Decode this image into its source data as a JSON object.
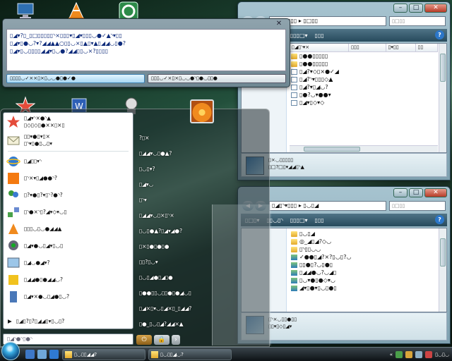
{
  "colors": {
    "accent": "#2b76c8",
    "taskbar": "#1b2226",
    "start_orb": "#3cb0e6",
    "dialog_text": "#0d2a7a"
  },
  "desktop": {
    "icons": [
      {
        "name": "computer-icon"
      },
      {
        "name": "vlc-icon"
      },
      {
        "name": "utorrent-icon"
      },
      {
        "name": "star-icon"
      },
      {
        "name": "word-icon"
      },
      {
        "name": "bot-icon"
      }
    ]
  },
  "dialog": {
    "lines": [
      "▯◢▾?▯_▯□▯▯▯▯▯◝×▯▯▯▾▯◢▾▯▯▯◡●✓▲◝▾▯▯",
      "▯◢▾▯●◡?▾?◢◢▲▲○▯▯◡×▯▲▯▾▲▯◢◢◡▯●?",
      "▯◢▾▯◡▯▯▯▯◢◢▾▯◡●?◢◢▯▯◡×?▯▯▯▯"
    ],
    "buttons": [
      {
        "label": "▯▯▯▯◡✓××▯×▯◡◡●▯●✓●"
      },
      {
        "label": "▯▯▯◡✓×▯×▯◡◡●◝▯●◡▯▯●"
      }
    ]
  },
  "window1": {
    "address": "▯◢▯◝▾▯▯▯ ▸ ▯□▯▯",
    "search_placeholder": "▯□▯▯",
    "toolbar": [
      "▯□▯▾",
      "▯▯◡▯◝",
      "▯▯▯□▾",
      "▯▯▯"
    ],
    "columns": [
      "▯◢▯◝▾×",
      "▯▯▯",
      "▯▾▯▯",
      "▯▯"
    ],
    "rows": [
      {
        "name": "▯●●▯▯▯▯▯",
        "type": "folder"
      },
      {
        "name": "▯●●▯▯▯▯▯",
        "type": "folder"
      },
      {
        "name": "▯◢?▾◇▯×●✓◢",
        "type": "file"
      },
      {
        "name": "▯◢?◝▾▯▯▯◇▲",
        "type": "file"
      },
      {
        "name": "▯◢?▾▯◢◡?",
        "type": "file"
      },
      {
        "name": "▯●?◡▾●●▾",
        "type": "file"
      },
      {
        "name": "▯◢▾▯◇▾◇",
        "type": "file"
      }
    ],
    "details": [
      "▯×◡▯▯▯▯▯",
      "▯□?□▯▾◢◢▯◝▲"
    ]
  },
  "window2": {
    "address": "▯◢▯◝▾▯▯▯ ▸ ▯◡▯◢",
    "search_placeholder": "▯□▯▯",
    "toolbar": [
      "▯□▯▾",
      "▯▯◡▯◝",
      "▯▯▯□▾",
      "▯▯▯"
    ],
    "rows": [
      {
        "name": "▯◡▯◢",
        "type": "folder"
      },
      {
        "name": "◎_◢▯◢?◇◡",
        "type": "folder"
      },
      {
        "name": "▯◝▯▯◡◡",
        "type": "folder"
      },
      {
        "name": "✓●●▯◢?×?▯◡▯?◡",
        "type": "img"
      },
      {
        "name": "▯▯●▯?◡▯●▯",
        "type": "img"
      },
      {
        "name": "▯◢◢●◡?◡◢▯",
        "type": "img"
      },
      {
        "name": "▯◡▾●▯●◇▾◡",
        "type": "img"
      },
      {
        "name": "◢▾▯●▾▯◡▯●▯",
        "type": "img"
      }
    ],
    "details": [
      "▯◝×◡▯▯●▯▯",
      "▯▯▾▯◇▯◢▾"
    ]
  },
  "start_menu": {
    "pinned": [
      {
        "name": "sm-item-favorites",
        "icon": "star-icon",
        "l1": "▯◢▾◝×●◝▲",
        "l2": "▯◇▯◇▯●××▯×▯"
      },
      {
        "name": "sm-item-email",
        "icon": "mail-icon",
        "l1": "▯▯▾●▯▾▯×",
        "l2": "▯◝▾▯●▯◡▯▾"
      }
    ],
    "recent": [
      {
        "name": "sm-item-ie",
        "icon": "ie-icon",
        "label": "▯◢▯▯▾◝"
      },
      {
        "name": "sm-item-orange",
        "icon": "orange-icon",
        "label": "▯◝×▾▯◢●●◝?"
      },
      {
        "name": "sm-item-messenger",
        "icon": "people-icon",
        "label": "▯?▾●▯?▾▯◝?●◝?"
      },
      {
        "name": "sm-item-network",
        "icon": "network-icon",
        "label": "▯◝●×◝▯?◢▾◇▾◡▯"
      },
      {
        "name": "sm-item-vlc",
        "icon": "cone-icon",
        "label": "▯▯▯◡▯◡●◢◢▲"
      },
      {
        "name": "sm-item-webcam",
        "icon": "webcam-icon",
        "label": "▯◢▾●◡▯◢▾▯◡▯"
      },
      {
        "name": "sm-item-paint",
        "icon": "paint-icon",
        "label": "▯◢◡●◢▾?"
      },
      {
        "name": "sm-item-puzzle",
        "icon": "puzzle-icon",
        "label": "▯◢◢●▯●◢◢◡?"
      },
      {
        "name": "sm-item-exit",
        "icon": "door-icon",
        "label": "▯◢▾×●◡▯◢●▯◡?"
      }
    ],
    "all_programs": "▯◢▯?▯?▯◢◢▯▾▯◡▯?",
    "search_placeholder": "▯◢◝●◝▯●◝",
    "right_links": [
      "?▯×",
      "▯◢◢▾◡▯●▲?",
      "▯◡▯▾?",
      "▯◢▾◡",
      "▯◝▾",
      "▯◢◢▾◡▯×▯◝×",
      "▯◡▯●▲?▯◢▾◢●?",
      "▯×▯●▯●▯●",
      "▯▯?▯◡▾",
      "▯◡▯◢●▯◢▯●",
      "▯●●▯▯◡▯▯●▯●◢◡▯",
      "▯◢×▯▾◡▯◢×▯_▯◢◢?",
      "▯●_▯◡▯◢?◢◢×▲"
    ]
  },
  "taskbar": {
    "tasks": [
      {
        "label": "▯◡▯▯◢◢?"
      },
      {
        "label": "▯◡▯▯◢◡?"
      }
    ],
    "clock": "▯◡▯◡"
  }
}
